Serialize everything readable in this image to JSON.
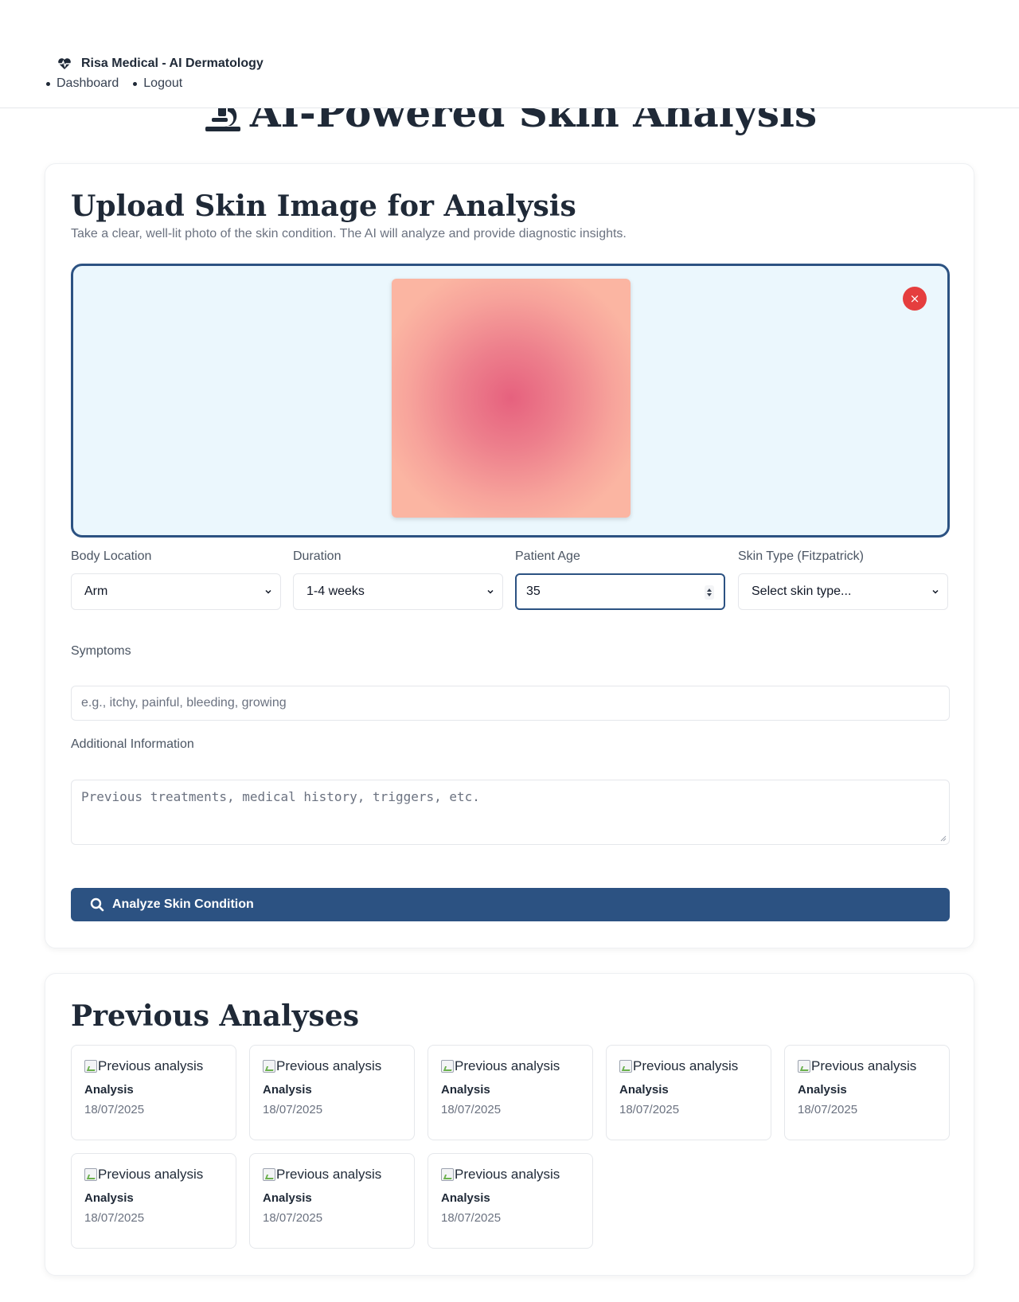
{
  "header": {
    "brand": "Risa Medical - AI Dermatology",
    "nav": [
      "Dashboard",
      "Logout"
    ]
  },
  "page_title": "AI-Powered Skin Analysis",
  "upload": {
    "title": "Upload Skin Image for Analysis",
    "subtitle": "Take a clear, well-lit photo of the skin condition. The AI will analyze and provide diagnostic insights.",
    "remove_icon": "×"
  },
  "form": {
    "body_location": {
      "label": "Body Location",
      "value": "Arm"
    },
    "duration": {
      "label": "Duration",
      "value": "1-4 weeks"
    },
    "patient_age": {
      "label": "Patient Age",
      "value": "35"
    },
    "skin_type": {
      "label": "Skin Type (Fitzpatrick)",
      "value": "Select skin type..."
    },
    "symptoms": {
      "label": "Symptoms",
      "placeholder": "e.g., itchy, painful, bleeding, growing"
    },
    "additional": {
      "label": "Additional Information",
      "placeholder": "Previous treatments, medical history, triggers, etc."
    },
    "analyze_button": "Analyze Skin Condition"
  },
  "history": {
    "title": "Previous Analyses",
    "items": [
      {
        "alt": "Previous analysis",
        "label": "Analysis",
        "date": "18/07/2025"
      },
      {
        "alt": "Previous analysis",
        "label": "Analysis",
        "date": "18/07/2025"
      },
      {
        "alt": "Previous analysis",
        "label": "Analysis",
        "date": "18/07/2025"
      },
      {
        "alt": "Previous analysis",
        "label": "Analysis",
        "date": "18/07/2025"
      },
      {
        "alt": "Previous analysis",
        "label": "Analysis",
        "date": "18/07/2025"
      },
      {
        "alt": "Previous analysis",
        "label": "Analysis",
        "date": "18/07/2025"
      },
      {
        "alt": "Previous analysis",
        "label": "Analysis",
        "date": "18/07/2025"
      },
      {
        "alt": "Previous analysis",
        "label": "Analysis",
        "date": "18/07/2025"
      }
    ]
  },
  "colors": {
    "primary": "#2c5282",
    "danger": "#e53e3e",
    "dropzone_bg": "#ebf7fd"
  }
}
